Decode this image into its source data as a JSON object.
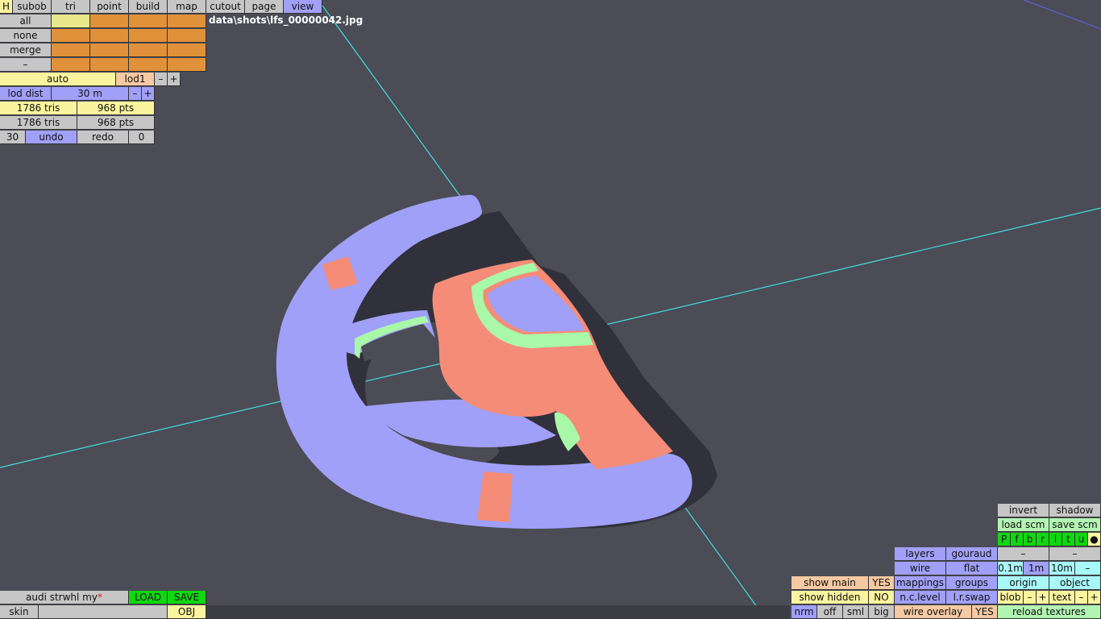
{
  "menu": {
    "h": "H",
    "tabs": [
      "subob",
      "tri",
      "point",
      "build",
      "map",
      "cutout",
      "page",
      "view"
    ],
    "active_tab": "view"
  },
  "select": {
    "all": "all",
    "none": "none",
    "merge": "merge",
    "dash": "–"
  },
  "lod": {
    "auto": "auto",
    "lod1": "lod1",
    "minus": "–",
    "plus": "+",
    "dist_label": "lod dist",
    "dist_value": "30 m"
  },
  "stats": {
    "row1_tris": "1786 tris",
    "row1_pts": "968 pts",
    "row2_tris": "1786 tris",
    "row2_pts": "968 pts"
  },
  "history": {
    "count_left": "30",
    "undo": "undo",
    "redo": "redo",
    "count_right": "0"
  },
  "filename": "data\\shots\\lfs_00000042.jpg",
  "file": {
    "name": "audi strwhl my",
    "modified_mark": "*",
    "load": "LOAD",
    "save": "SAVE",
    "skin": "skin",
    "obj": "OBJ"
  },
  "view_panel": {
    "invert": "invert",
    "shadow": "shadow",
    "load_scm": "load scm",
    "save_scm": "save scm",
    "view_keys": [
      "P",
      "f",
      "b",
      "r",
      "l",
      "t",
      "u",
      "●"
    ],
    "dash": "–",
    "layers": "layers",
    "gouraud": "gouraud",
    "wire": "wire",
    "flat": "flat",
    "mappings": "mappings",
    "groups": "groups",
    "nc_level": "n.c.level",
    "lr_swap": "l.r.swap",
    "wire_overlay": "wire overlay",
    "wire_overlay_value": "YES",
    "grid": [
      "0.1m",
      "1m",
      "10m"
    ],
    "origin": "origin",
    "object": "object",
    "blob": "blob",
    "text": "text",
    "reload_textures": "reload textures",
    "show_main": "show main",
    "show_main_value": "YES",
    "show_hidden": "show hidden",
    "show_hidden_value": "NO",
    "nrm": "nrm",
    "off": "off",
    "sml": "sml",
    "big": "big"
  },
  "colors": {
    "background": "#4b4c55",
    "model_rim": "#a0a0f8",
    "model_center": "#f48c78",
    "model_trim": "#a8f8a8",
    "guide_line": "#40e0e0"
  }
}
